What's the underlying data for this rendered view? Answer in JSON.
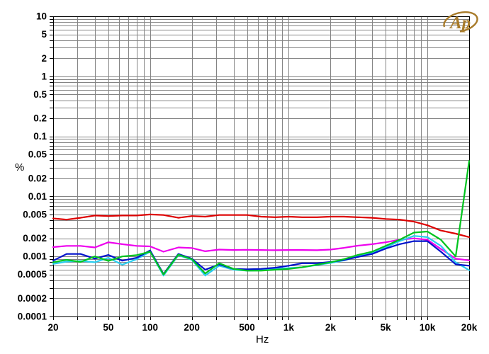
{
  "logo": {
    "text": "Ap",
    "color": "#a87b2a",
    "description": "Audio Precision logo"
  },
  "chart_data": {
    "type": "line",
    "title": "",
    "xlabel": "Hz",
    "ylabel": "%",
    "x_scale": "log",
    "y_scale": "log",
    "xlim": [
      20,
      20000
    ],
    "ylim": [
      0.0001,
      10
    ],
    "grid": "log minor gridlines on both axes, gray",
    "legend_position": "none",
    "x_tick_labels": [
      {
        "f": 20,
        "label": "20"
      },
      {
        "f": 50,
        "label": "50"
      },
      {
        "f": 100,
        "label": "100"
      },
      {
        "f": 200,
        "label": "200"
      },
      {
        "f": 500,
        "label": "500"
      },
      {
        "f": 1000,
        "label": "1k"
      },
      {
        "f": 2000,
        "label": "2k"
      },
      {
        "f": 5000,
        "label": "5k"
      },
      {
        "f": 10000,
        "label": "10k"
      },
      {
        "f": 20000,
        "label": "20k"
      }
    ],
    "y_tick_labels": [
      {
        "v": 10,
        "label": "10"
      },
      {
        "v": 5,
        "label": "5"
      },
      {
        "v": 2,
        "label": "2"
      },
      {
        "v": 1,
        "label": "1"
      },
      {
        "v": 0.5,
        "label": "0.5"
      },
      {
        "v": 0.2,
        "label": "0.2"
      },
      {
        "v": 0.1,
        "label": "0.1"
      },
      {
        "v": 0.05,
        "label": "0.05"
      },
      {
        "v": 0.02,
        "label": "0.02"
      },
      {
        "v": 0.01,
        "label": "0.01"
      },
      {
        "v": 0.005,
        "label": "0.005"
      },
      {
        "v": 0.002,
        "label": "0.002"
      },
      {
        "v": 0.001,
        "label": "0.001"
      },
      {
        "v": 0.0005,
        "label": "0.0005"
      },
      {
        "v": 0.0002,
        "label": "0.0002"
      },
      {
        "v": 0.0001,
        "label": "0.0001"
      }
    ],
    "frequencies_hz": [
      20,
      25,
      31.5,
      40,
      50,
      63,
      80,
      100,
      125,
      160,
      200,
      250,
      315,
      400,
      500,
      630,
      800,
      1000,
      1250,
      1600,
      2000,
      2500,
      3150,
      4000,
      5000,
      6300,
      8000,
      10000,
      12500,
      16000,
      20000
    ],
    "series": [
      {
        "name": "trace-red",
        "color": "#dd0000",
        "values": [
          0.0043,
          0.0041,
          0.0044,
          0.0048,
          0.0047,
          0.0048,
          0.0048,
          0.005,
          0.0049,
          0.0044,
          0.0047,
          0.0046,
          0.0049,
          0.0049,
          0.0049,
          0.0046,
          0.0045,
          0.0046,
          0.0045,
          0.0045,
          0.0046,
          0.0046,
          0.0045,
          0.0044,
          0.0042,
          0.0041,
          0.0038,
          0.0033,
          0.0027,
          0.0024,
          0.0021
        ]
      },
      {
        "name": "trace-magenta",
        "color": "#ee00ee",
        "values": [
          0.00143,
          0.0015,
          0.0015,
          0.00141,
          0.00172,
          0.0016,
          0.0015,
          0.00147,
          0.0012,
          0.00141,
          0.00138,
          0.00122,
          0.0013,
          0.00128,
          0.00129,
          0.00128,
          0.00127,
          0.00128,
          0.00128,
          0.00127,
          0.0013,
          0.00139,
          0.00151,
          0.0016,
          0.00172,
          0.0019,
          0.002,
          0.0019,
          0.00133,
          0.00092,
          0.00086
        ]
      },
      {
        "name": "trace-cyan",
        "color": "#2accee",
        "values": [
          0.00075,
          0.00082,
          0.00084,
          0.0008,
          0.00095,
          0.00073,
          0.0009,
          0.0012,
          0.00048,
          0.00105,
          0.00088,
          0.00048,
          0.0007,
          0.0006,
          0.00058,
          0.00059,
          0.00062,
          0.00064,
          0.00066,
          0.00072,
          0.00078,
          0.00086,
          0.001,
          0.00114,
          0.00142,
          0.0018,
          0.0022,
          0.0021,
          0.0015,
          0.0008,
          0.00059
        ]
      },
      {
        "name": "trace-blue",
        "color": "#0011cc",
        "values": [
          0.00085,
          0.0011,
          0.0011,
          0.00092,
          0.00106,
          0.00085,
          0.00095,
          0.00126,
          0.00051,
          0.0011,
          0.00092,
          0.0006,
          0.00074,
          0.00062,
          0.00061,
          0.00062,
          0.00065,
          0.0007,
          0.00077,
          0.00077,
          0.00081,
          0.00087,
          0.00098,
          0.0011,
          0.00135,
          0.0016,
          0.0018,
          0.0018,
          0.0012,
          0.00074,
          0.0007
        ]
      },
      {
        "name": "trace-green",
        "color": "#00c41e",
        "values": [
          0.0008,
          0.00088,
          0.00081,
          0.001,
          0.00084,
          0.001,
          0.00105,
          0.0012,
          0.0005,
          0.00107,
          0.0009,
          0.00052,
          0.00077,
          0.00062,
          0.00058,
          0.00058,
          0.0006,
          0.00062,
          0.00066,
          0.00073,
          0.0008,
          0.0009,
          0.00106,
          0.0012,
          0.0015,
          0.0019,
          0.0025,
          0.0026,
          0.0019,
          0.001,
          0.039
        ]
      }
    ]
  },
  "style": {
    "grid_color": "#848484",
    "frame_color": "#000000",
    "tick_label_color": "#000000"
  }
}
